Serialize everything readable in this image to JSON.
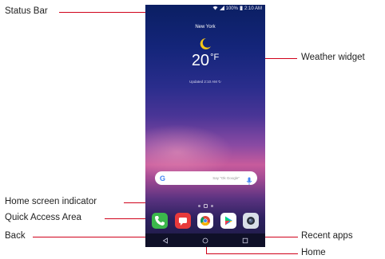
{
  "callouts": {
    "status_bar": "Status Bar",
    "weather_widget": "Weather widget",
    "home_screen_indicator": "Home screen indicator",
    "quick_access_area": "Quick Access Area",
    "back": "Back",
    "recent_apps": "Recent apps",
    "home": "Home"
  },
  "status_bar": {
    "wifi_icon": "wifi-icon",
    "signal_icon": "signal-icon",
    "battery_percent": "100%",
    "battery_icon": "battery-icon",
    "time": "2:10 AM"
  },
  "weather": {
    "city": "New York",
    "icon": "moon-icon",
    "temperature": "20",
    "unit": "°F",
    "updated": "Updated 2:10 AM",
    "refresh_icon": "refresh-icon"
  },
  "search": {
    "logo": "G",
    "placeholder": "Say \"Ok Google\"",
    "mic_icon": "mic-icon"
  },
  "dock": {
    "apps": [
      "phone-icon",
      "messaging-icon",
      "chrome-icon",
      "play-store-icon",
      "camera-icon"
    ]
  },
  "colors": {
    "leader": "#d0021b",
    "accent_green": "#3bb84b",
    "accent_red": "#e8393b"
  }
}
